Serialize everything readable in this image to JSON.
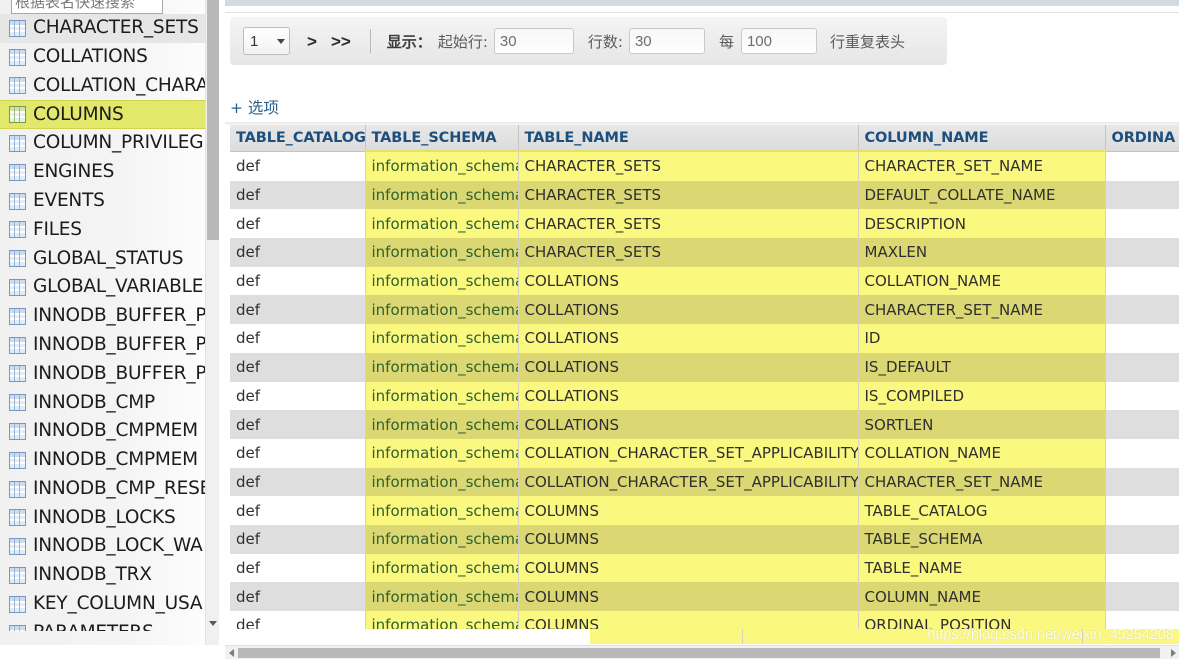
{
  "sidebar": {
    "search": {
      "placeholder": "根据表名快速搜索",
      "value": ""
    },
    "items": [
      {
        "label": "CHARACTER_SETS",
        "state": "hover"
      },
      {
        "label": "COLLATIONS",
        "state": "normal"
      },
      {
        "label": "COLLATION_CHARA",
        "state": "normal"
      },
      {
        "label": "COLUMNS",
        "state": "selected"
      },
      {
        "label": "COLUMN_PRIVILEG",
        "state": "normal"
      },
      {
        "label": "ENGINES",
        "state": "normal"
      },
      {
        "label": "EVENTS",
        "state": "normal"
      },
      {
        "label": "FILES",
        "state": "normal"
      },
      {
        "label": "GLOBAL_STATUS",
        "state": "normal"
      },
      {
        "label": "GLOBAL_VARIABLE",
        "state": "normal"
      },
      {
        "label": "INNODB_BUFFER_P",
        "state": "normal"
      },
      {
        "label": "INNODB_BUFFER_P",
        "state": "normal"
      },
      {
        "label": "INNODB_BUFFER_P",
        "state": "normal"
      },
      {
        "label": "INNODB_CMP",
        "state": "normal"
      },
      {
        "label": "INNODB_CMPMEM",
        "state": "normal"
      },
      {
        "label": "INNODB_CMPMEM",
        "state": "normal"
      },
      {
        "label": "INNODB_CMP_RESE",
        "state": "normal"
      },
      {
        "label": "INNODB_LOCKS",
        "state": "normal"
      },
      {
        "label": "INNODB_LOCK_WA",
        "state": "normal"
      },
      {
        "label": "INNODB_TRX",
        "state": "normal"
      },
      {
        "label": "KEY_COLUMN_USA",
        "state": "normal"
      },
      {
        "label": "PARAMETERS",
        "state": "normal"
      }
    ]
  },
  "toolbar": {
    "page_value": "1",
    "next_page_label": ">",
    "last_page_label": ">>",
    "show_label": "显示：",
    "start_row_label": "起始行:",
    "start_row_value": "30",
    "row_count_label": "行数:",
    "row_count_value": "30",
    "every_label": "每",
    "every_value": "100",
    "repeat_header_label": "行重复表头"
  },
  "options_link": "+ 选项",
  "grid": {
    "columns": [
      "TABLE_CATALOG",
      "TABLE_SCHEMA",
      "TABLE_NAME",
      "COLUMN_NAME",
      "ORDINA"
    ],
    "rows": [
      [
        "def",
        "information_schema",
        "CHARACTER_SETS",
        "CHARACTER_SET_NAME",
        ""
      ],
      [
        "def",
        "information_schema",
        "CHARACTER_SETS",
        "DEFAULT_COLLATE_NAME",
        ""
      ],
      [
        "def",
        "information_schema",
        "CHARACTER_SETS",
        "DESCRIPTION",
        ""
      ],
      [
        "def",
        "information_schema",
        "CHARACTER_SETS",
        "MAXLEN",
        ""
      ],
      [
        "def",
        "information_schema",
        "COLLATIONS",
        "COLLATION_NAME",
        ""
      ],
      [
        "def",
        "information_schema",
        "COLLATIONS",
        "CHARACTER_SET_NAME",
        ""
      ],
      [
        "def",
        "information_schema",
        "COLLATIONS",
        "ID",
        ""
      ],
      [
        "def",
        "information_schema",
        "COLLATIONS",
        "IS_DEFAULT",
        ""
      ],
      [
        "def",
        "information_schema",
        "COLLATIONS",
        "IS_COMPILED",
        ""
      ],
      [
        "def",
        "information_schema",
        "COLLATIONS",
        "SORTLEN",
        ""
      ],
      [
        "def",
        "information_schema",
        "COLLATION_CHARACTER_SET_APPLICABILITY",
        "COLLATION_NAME",
        ""
      ],
      [
        "def",
        "information_schema",
        "COLLATION_CHARACTER_SET_APPLICABILITY",
        "CHARACTER_SET_NAME",
        ""
      ],
      [
        "def",
        "information_schema",
        "COLUMNS",
        "TABLE_CATALOG",
        ""
      ],
      [
        "def",
        "information_schema",
        "COLUMNS",
        "TABLE_SCHEMA",
        ""
      ],
      [
        "def",
        "information_schema",
        "COLUMNS",
        "TABLE_NAME",
        ""
      ],
      [
        "def",
        "information_schema",
        "COLUMNS",
        "COLUMN_NAME",
        ""
      ],
      [
        "def",
        "information_schema",
        "COLUMNS",
        "ORDINAL_POSITION",
        ""
      ]
    ]
  },
  "watermark": "https://blog.csdn.net/weixin_45254208",
  "colors": {
    "selected_row": "#e2e86a",
    "highlight_cell_odd": "#fbf87f",
    "highlight_cell_even": "#dbd873",
    "header_text": "#1d4f7c",
    "link": "#26608c"
  }
}
